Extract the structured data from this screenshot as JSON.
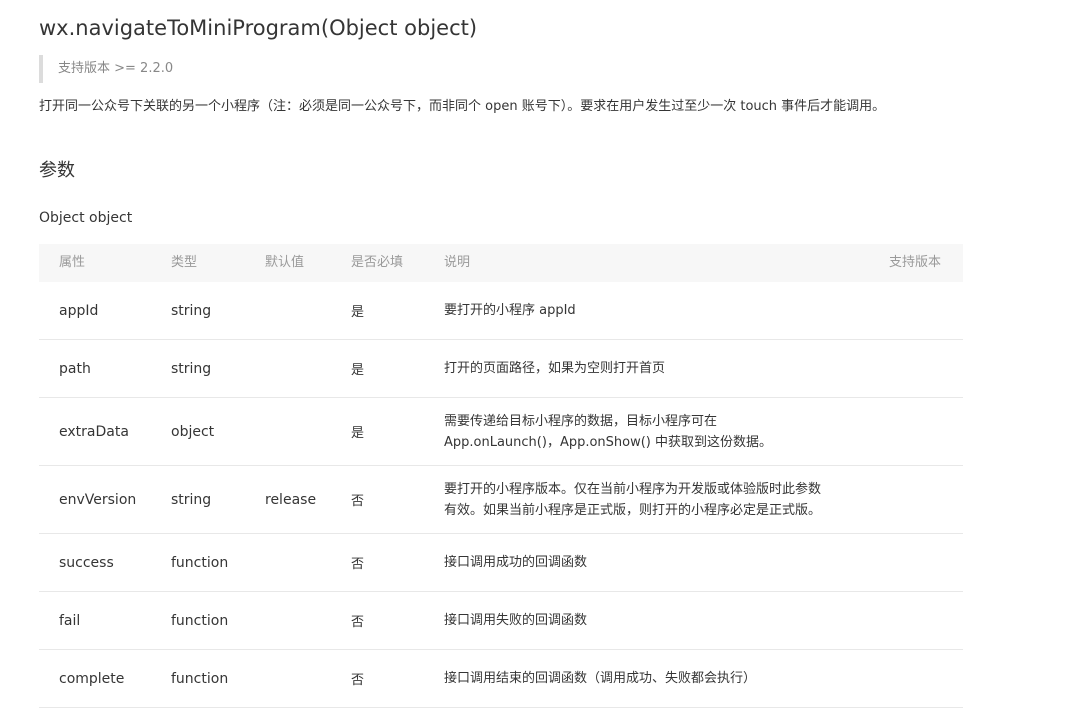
{
  "api_title": "wx.navigateToMiniProgram(Object object)",
  "version_note": "支持版本 >= 2.2.0",
  "description": "打开同一公众号下关联的另一个小程序（注：必须是同一公众号下，而非同个 open 账号下）。要求在用户发生过至少一次 touch 事件后才能调用。",
  "section_heading": "参数",
  "object_label": "Object object",
  "table": {
    "headers": [
      "属性",
      "类型",
      "默认值",
      "是否必填",
      "说明",
      "支持版本"
    ],
    "rows": [
      {
        "name": "appId",
        "type": "string",
        "default": "",
        "required": "是",
        "desc1": "要打开的小程序 appId",
        "desc2": "",
        "version": ""
      },
      {
        "name": "path",
        "type": "string",
        "default": "",
        "required": "是",
        "desc1": "打开的页面路径，如果为空则打开首页",
        "desc2": "",
        "version": ""
      },
      {
        "name": "extraData",
        "type": "object",
        "default": "",
        "required": "是",
        "desc1": "需要传递给目标小程序的数据，目标小程序可在",
        "desc2": "App.onLaunch()，App.onShow() 中获取到这份数据。",
        "version": ""
      },
      {
        "name": "envVersion",
        "type": "string",
        "default": "release",
        "required": "否",
        "desc1": "要打开的小程序版本。仅在当前小程序为开发版或体验版时此参数",
        "desc2": "有效。如果当前小程序是正式版，则打开的小程序必定是正式版。",
        "version": ""
      },
      {
        "name": "success",
        "type": "function",
        "default": "",
        "required": "否",
        "desc1": "接口调用成功的回调函数",
        "desc2": "",
        "version": ""
      },
      {
        "name": "fail",
        "type": "function",
        "default": "",
        "required": "否",
        "desc1": "接口调用失败的回调函数",
        "desc2": "",
        "version": ""
      },
      {
        "name": "complete",
        "type": "function",
        "default": "",
        "required": "否",
        "desc1": "接口调用结束的回调函数（调用成功、失败都会执行）",
        "desc2": "",
        "version": ""
      }
    ]
  }
}
